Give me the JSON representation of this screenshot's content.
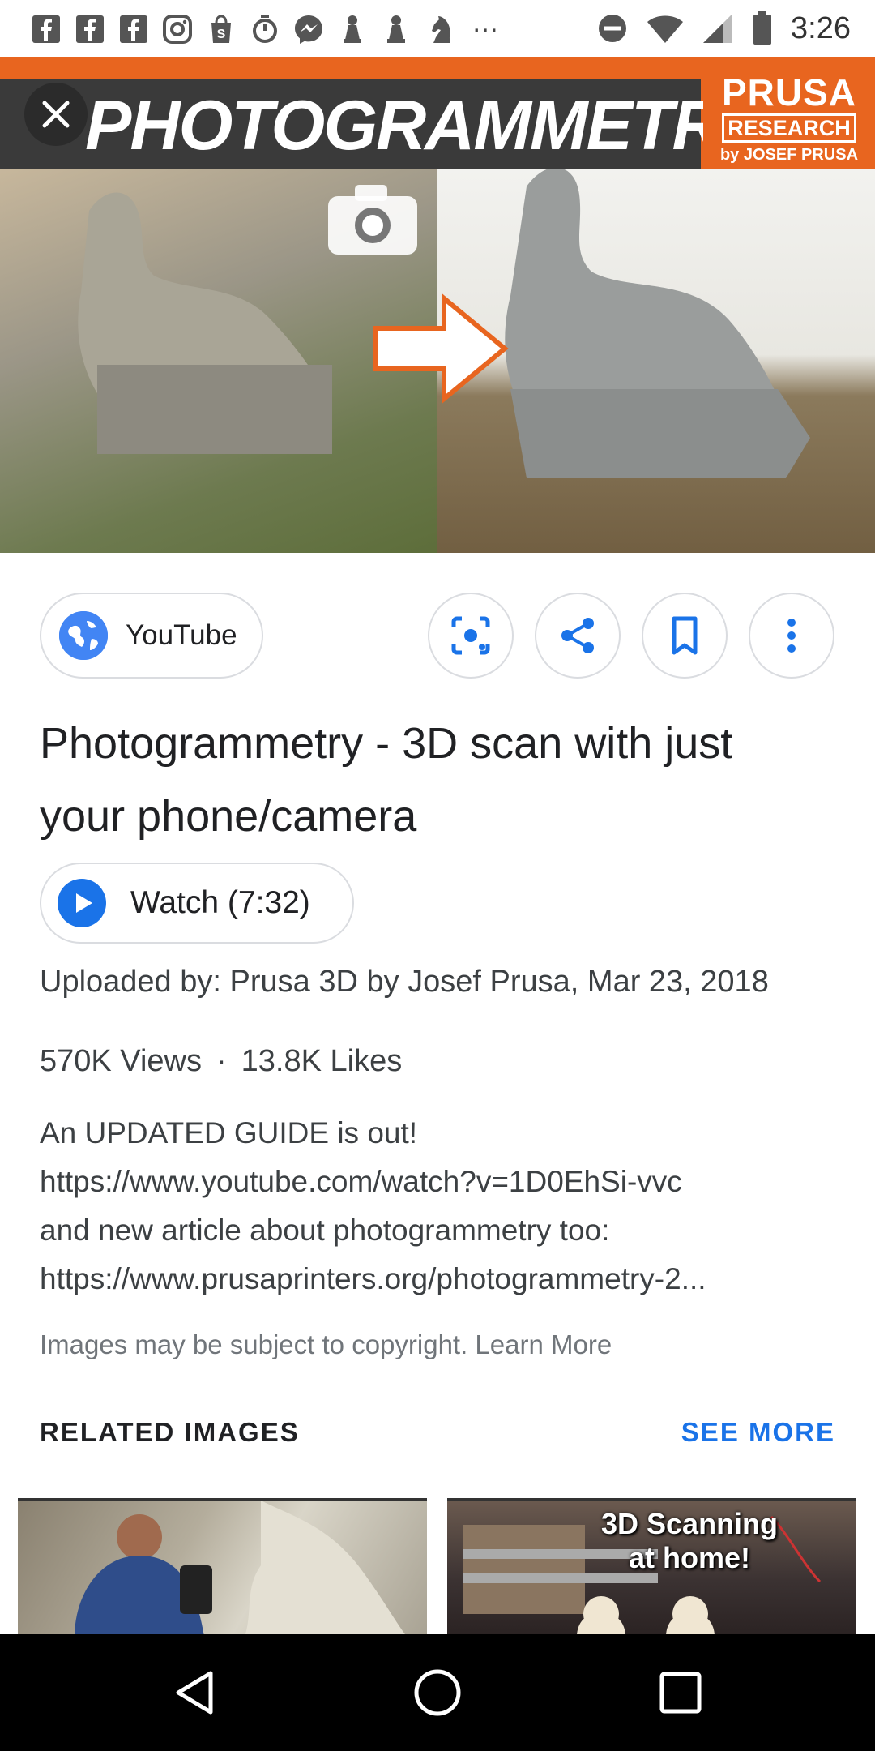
{
  "status_bar": {
    "time": "3:26",
    "notification_icons": [
      "facebook-icon",
      "facebook-icon",
      "facebook-icon",
      "instagram-icon",
      "shopping-bag-icon",
      "timer-icon",
      "messenger-icon",
      "pawn-icon",
      "pawn-icon",
      "chess-knight-icon"
    ],
    "overflow": "…"
  },
  "hero": {
    "title": "PHOTOGRAMMETRY",
    "brand_name": "PRUSA",
    "brand_sub": "RESEARCH",
    "brand_by": "by JOSEF PRUSA",
    "accent_color": "#e8651f"
  },
  "actions": {
    "source_label": "YouTube"
  },
  "result": {
    "title": "Photogrammetry - 3D scan with just your phone/camera",
    "watch_label": "Watch (7:32)",
    "uploaded": "Uploaded by: Prusa 3D by Josef Prusa, Mar 23, 2018",
    "views": "570K Views",
    "separator": "·",
    "likes": "13.8K Likes",
    "description_lines": [
      "An UPDATED GUIDE is out!",
      "https://www.youtube.com/watch?v=1D0EhSi-vvc",
      "and new article about photogrammetry too:",
      "https://www.prusaprinters.org/photogrammetry-2..."
    ],
    "copyright": "Images may be subject to copyright. Learn More"
  },
  "related": {
    "heading": "RELATED IMAGES",
    "see_more": "SEE MORE",
    "thumb2_caption_line1": "3D Scanning",
    "thumb2_caption_line2": "at home!"
  },
  "colors": {
    "link_blue": "#1a73e8",
    "globe_blue": "#4285f4"
  }
}
